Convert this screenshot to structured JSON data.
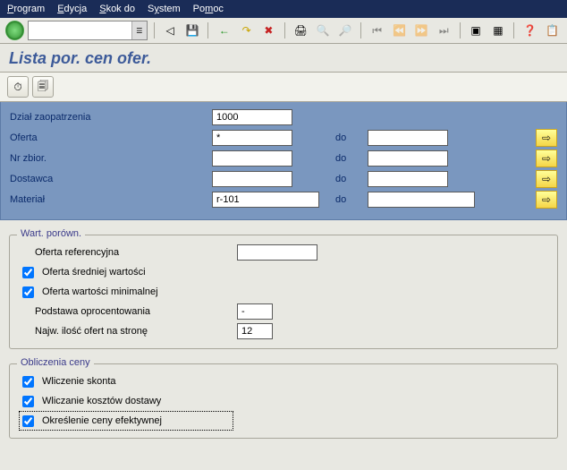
{
  "menubar": {
    "program": "Program",
    "edycja": "Edycja",
    "skokdo": "Skok do",
    "system": "System",
    "pomoc": "Pomoc"
  },
  "toolbar_icons": {
    "back": "◁",
    "save": "💾",
    "gback": "←",
    "gup": "↷",
    "gcancel": "✖",
    "print": "🖨",
    "find": "🔍",
    "findnext": "🔎",
    "first": "⏮",
    "pgup": "⏪",
    "pgdn": "⏩",
    "last": "⏭",
    "newwin": "▣",
    "layout": "▦",
    "help": "❓",
    "menu": "📋"
  },
  "title": "Lista por. cen ofer.",
  "app_toolbar": {
    "execute": "⏱",
    "variant": "🗐"
  },
  "selection": {
    "labels": {
      "dzial": "Dział zaopatrzenia",
      "oferta": "Oferta",
      "nrzbior": "Nr zbior.",
      "dostawca": "Dostawca",
      "material": "Materiał",
      "do": "do"
    },
    "values": {
      "dzial": "1000",
      "oferta_from": "*",
      "oferta_to": "",
      "nrzbior_from": "",
      "nrzbior_to": "",
      "dostawca_from": "",
      "dostawca_to": "",
      "material_from": "r-101",
      "material_to": ""
    },
    "arrow": "⇨"
  },
  "group1": {
    "title": "Wart. porówn.",
    "labels": {
      "ref": "Oferta referencyjna",
      "avg": "Oferta średniej wartości",
      "min": "Oferta wartości minimalnej",
      "base": "Podstawa oprocentowania",
      "max": "Najw. ilość ofert na stronę"
    },
    "values": {
      "ref": "",
      "avg_checked": true,
      "min_checked": true,
      "base": "-",
      "max": "12"
    }
  },
  "group2": {
    "title": "Obliczenia ceny",
    "labels": {
      "skonto": "Wliczenie skonta",
      "dostawy": "Wliczanie kosztów dostawy",
      "efekt": "Określenie ceny efektywnej"
    },
    "values": {
      "skonto_checked": true,
      "dostawy_checked": true,
      "efekt_checked": true
    }
  }
}
